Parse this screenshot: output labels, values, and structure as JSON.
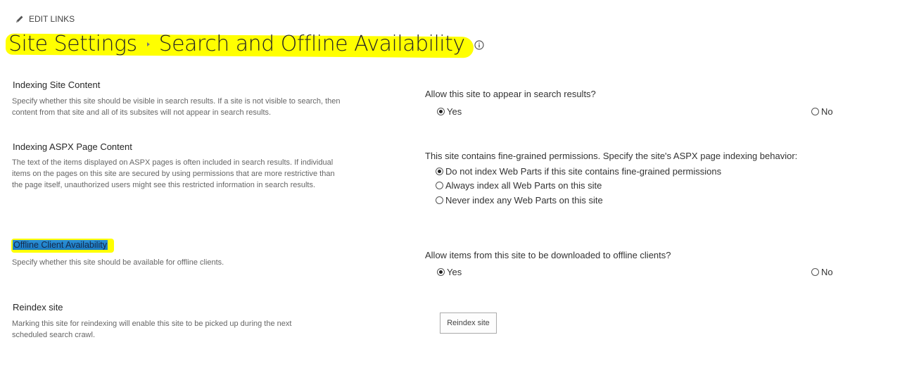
{
  "header": {
    "edit_links": "EDIT LINKS",
    "title_part1": "Site Settings",
    "title_part2": "Search and Offline Availability",
    "edit_icon": "pencil-icon",
    "info_icon": "info-icon"
  },
  "sections": {
    "indexing_site": {
      "title": "Indexing Site Content",
      "description": "Specify whether this site should be visible in search results. If a site is not visible to search, then content from that site and all of its subsites will not appear in search results.",
      "question": "Allow this site to appear in search results?",
      "options": [
        {
          "label": "Yes",
          "checked": true
        },
        {
          "label": "No",
          "checked": false
        }
      ]
    },
    "indexing_aspx": {
      "title": "Indexing ASPX Page Content",
      "description": "The text of the items displayed on ASPX pages is often included in search results. If individual items on the pages on this site are secured by using permissions that are more restrictive than the page itself, unauthorized users might see this restricted information in search results.",
      "question": "This site contains fine-grained permissions. Specify the site's ASPX page indexing behavior:",
      "options": [
        {
          "label": "Do not index Web Parts if this site contains fine-grained permissions",
          "checked": true
        },
        {
          "label": "Always index all Web Parts on this site",
          "checked": false
        },
        {
          "label": "Never index any Web Parts on this site",
          "checked": false
        }
      ]
    },
    "offline": {
      "title": "Offline Client Availability",
      "description": "Specify whether this site should be available for offline clients.",
      "question": "Allow items from this site to be downloaded to offline clients?",
      "options": [
        {
          "label": "Yes",
          "checked": true
        },
        {
          "label": "No",
          "checked": false
        }
      ]
    },
    "reindex": {
      "title": "Reindex site",
      "description": "Marking this site for reindexing will enable this site to be picked up during the next scheduled search crawl.",
      "button_label": "Reindex site"
    }
  },
  "colors": {
    "highlight": "#ffff00",
    "selection": "#1f86d0",
    "title_text": "#262626",
    "description_text": "#666666"
  }
}
